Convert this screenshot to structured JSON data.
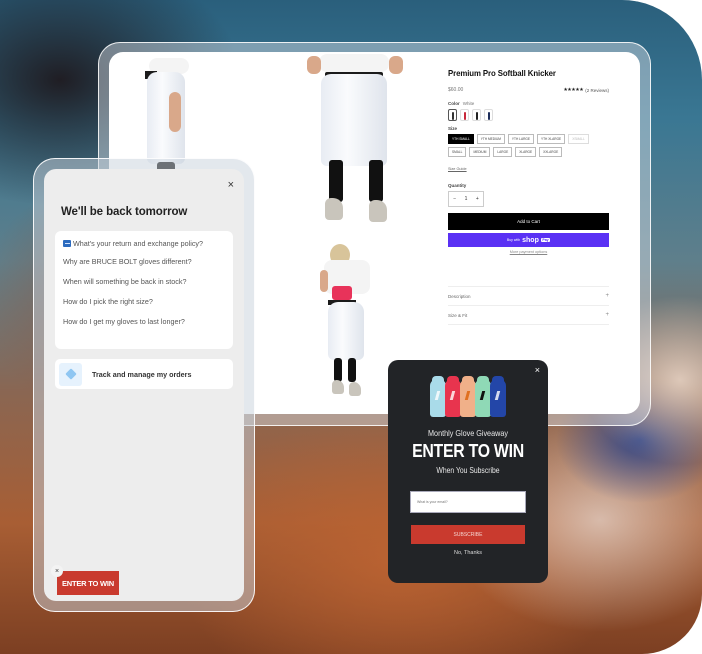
{
  "product": {
    "title": "Premium Pro Softball Knicker",
    "price": "$60.00",
    "rating_stars": "★★★★★",
    "reviews": "(2 Reviews)",
    "rating_value": 5,
    "color_label": "Color",
    "color_value": "White",
    "swatches": [
      {
        "name": "white",
        "accent": "#333333",
        "selected": true
      },
      {
        "name": "red",
        "accent": "#c8283a",
        "selected": false
      },
      {
        "name": "black",
        "accent": "#222222",
        "selected": false
      },
      {
        "name": "navy",
        "accent": "#1d2d5a",
        "selected": false
      }
    ],
    "size_label": "Size",
    "sizes": [
      {
        "label": "YTH SMALL",
        "state": "selected"
      },
      {
        "label": "YTH MEDIUM",
        "state": "available"
      },
      {
        "label": "YTH LARGE",
        "state": "available"
      },
      {
        "label": "YTH XLARGE",
        "state": "available"
      },
      {
        "label": "XSMALL",
        "state": "disabled"
      },
      {
        "label": "SMALL",
        "state": "available"
      },
      {
        "label": "MEDIUM",
        "state": "available"
      },
      {
        "label": "LARGE",
        "state": "available"
      },
      {
        "label": "XLARGE",
        "state": "available"
      },
      {
        "label": "XXLARGE",
        "state": "available"
      }
    ],
    "size_guide": "Size Guide",
    "quantity_label": "Quantity",
    "quantity_minus": "−",
    "quantity_value": "1",
    "quantity_plus": "+",
    "add_to_cart": "Add to Cart",
    "buy_with": "Buy with",
    "shop_word": "shop",
    "pay_word": "Pay",
    "more_payment": "More payment options",
    "accordion": [
      {
        "label": "Description",
        "icon": "+"
      },
      {
        "label": "Size & Fit",
        "icon": "+"
      }
    ]
  },
  "chat": {
    "close": "×",
    "title": "We'll be back tomorrow",
    "faqs": [
      "What's your return and exchange policy?",
      "Why are BRUCE BOLT gloves different?",
      "When will something be back in stock?",
      "How do I pick the right size?",
      "How do I get my gloves to last longer?"
    ],
    "track_label": "Track and manage my orders"
  },
  "floating_cta": {
    "close": "×",
    "label": "ENTER TO WIN"
  },
  "popup": {
    "close": "×",
    "subtitle": "Monthly Glove Giveaway",
    "headline": "ENTER TO WIN",
    "subtitle2": "When You Subscribe",
    "email_placeholder": "What is your email?",
    "subscribe": "SUBSCRIBE",
    "no_thanks": "No, Thanks",
    "glove_colors": [
      "#a9dbe9",
      "#e8344e",
      "#f0b089",
      "#8fd9b6",
      "#2346a8"
    ]
  }
}
